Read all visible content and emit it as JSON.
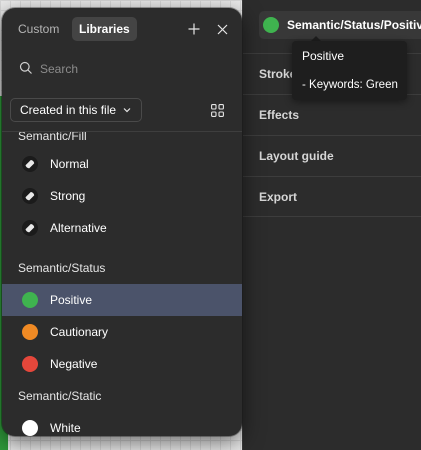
{
  "popover": {
    "tabs": [
      {
        "label": "Custom",
        "active": false
      },
      {
        "label": "Libraries",
        "active": true
      }
    ],
    "add_icon": "plus-icon",
    "close_icon": "close-icon",
    "search": {
      "placeholder": "Search",
      "value": "",
      "icon": "search-icon"
    },
    "filter": {
      "label": "Created in this file",
      "icon": "chevron-down-icon"
    },
    "view_toggle_icon": "grid-view-icon",
    "groups": [
      {
        "name": "Semantic/Fill",
        "items": [
          {
            "name": "Normal",
            "swatch": "fill-style-icon"
          },
          {
            "name": "Strong",
            "swatch": "fill-style-icon"
          },
          {
            "name": "Alternative",
            "swatch": "fill-style-icon"
          }
        ]
      },
      {
        "name": "Semantic/Status",
        "items": [
          {
            "name": "Positive",
            "color": "#3fb34f",
            "selected": true
          },
          {
            "name": "Cautionary",
            "color": "#f08a24"
          },
          {
            "name": "Negative",
            "color": "#e5473b"
          }
        ]
      },
      {
        "name": "Semantic/Static",
        "items": [
          {
            "name": "White",
            "color": "#ffffff"
          }
        ]
      }
    ]
  },
  "properties": {
    "selected_style": {
      "label": "Semantic/Status/Positive",
      "color": "#3fb34f"
    },
    "sections": [
      "Stroke",
      "Effects",
      "Layout guide",
      "Export"
    ]
  },
  "tooltip": {
    "title": "Positive",
    "body": "- Keywords: Green"
  },
  "colors": {
    "panel_bg": "#2c2c2c",
    "selected_row": "#4b536a",
    "accent_green": "#3fb34f"
  }
}
